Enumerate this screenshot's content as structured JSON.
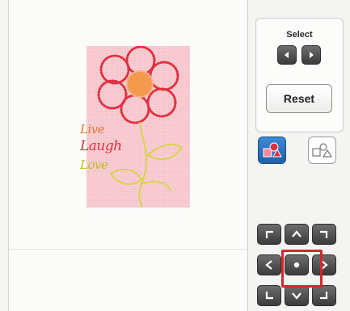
{
  "select_panel": {
    "label": "Select",
    "prev_icon": "left-arrow-icon",
    "next_icon": "right-arrow-icon"
  },
  "reset_button": {
    "label": "Reset"
  },
  "mode_buttons": [
    {
      "icon": "colored-shapes-icon",
      "selected": true
    },
    {
      "icon": "outline-shapes-icon",
      "selected": false
    }
  ],
  "design": {
    "words": [
      "Live",
      "Laugh",
      "Love"
    ]
  },
  "move_pad": {
    "icons": [
      "up-left-corner-icon",
      "up-arrow-icon",
      "up-right-corner-icon",
      "left-arrow-icon",
      "center-dot-icon",
      "right-arrow-icon",
      "down-left-corner-icon",
      "down-arrow-icon",
      "down-right-corner-icon"
    ],
    "highlighted": "center-dot-icon"
  },
  "colors": {
    "design_background": "#f5c4cc",
    "petal_outline": "#e0303d",
    "flower_center": "#f39a4c",
    "stem": "#d6d63a",
    "selected_mode": "#2c6fc0",
    "highlight": "#d8262a"
  }
}
